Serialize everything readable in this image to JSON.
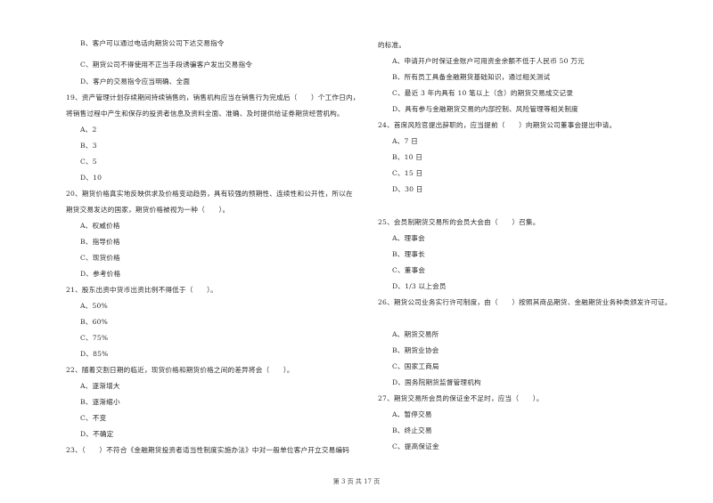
{
  "left_column": {
    "q18_options": {
      "B": "B、客户可以通过电话向期货公司下达交易指令",
      "C": "C、期货公司不得使用不正当手段诱骗客户发出交易指令",
      "D": "D、客户的交易指令应当明确、全面"
    },
    "q19": {
      "line1": "19、资产管理计划存续期间持续销售的，销售机构应当在销售行为完成后（　　）个工作日内，",
      "line2": "将销售过程中产生和保存的投资者信息及资料全面、准确、及时提供给证券期货经营机构。",
      "options": [
        "A、2",
        "B、3",
        "C、5",
        "D、10"
      ]
    },
    "q20": {
      "line1": "20、期货价格真实地反映供求及价格变动趋势，具有较强的预期性、连续性和公开性，所以在",
      "line2": "期货交易发达的国家，期货价格被视为一种（　　）。",
      "options": [
        "A、权威价格",
        "B、指导价格",
        "C、现货价格",
        "D、参考价格"
      ]
    },
    "q21": {
      "line1": "21、股东出资中货币出资比例不得低于（　　）。",
      "options": [
        "A、50%",
        "B、60%",
        "C、75%",
        "D、85%"
      ]
    },
    "q22": {
      "line1": "22、随着交割日期的临近，现货价格和期货价格之间的差异将会（　　）。",
      "options": [
        "A、逐渐增大",
        "B、逐渐缩小",
        "C、不变",
        "D、不确定"
      ]
    },
    "q23": {
      "line1": "23、（　　）不符合《金融期货投资者适当性制度实施办法》中对一般单位客户开立交易编码"
    }
  },
  "right_column": {
    "q23_cont": "的标准。",
    "q23_options": [
      "A、申请开户时保证金账户可用资金余额不低于人民币 50 万元",
      "B、所有员工具备金融期货基础知识，通过相关测试",
      "C、最近 3 年内具有 10 笔以上（含）的期货交易成交记录",
      "D、具有参与金融期货交易的内部控制、风险管理等相关制度"
    ],
    "q24": {
      "line1": "24、首席风险官提出辞职的，应当提前（　　）向期货公司董事会提出申请。",
      "options": [
        "A、7 日",
        "B、10 日",
        "C、15 日",
        "D、30 日"
      ]
    },
    "q25": {
      "line1": "25、会员制期货交易所的会员大会由（　　）召集。",
      "options": [
        "A、理事会",
        "B、理事长",
        "C、董事会",
        "D、1/3 以上会员"
      ]
    },
    "q26": {
      "line1": "26、期货公司业务实行许可制度，由（　　）按照其商品期货、金融期货业务种类颁发许可证。",
      "options": [
        "A、期货交易所",
        "B、期货业协会",
        "C、国家工商局",
        "D、国务院期货监督管理机构"
      ]
    },
    "q27": {
      "line1": "27、期货交易所会员的保证金不足时，应当（　　）。",
      "options": [
        "A、暂停交易",
        "B、终止交易",
        "C、提高保证金"
      ]
    }
  },
  "footer": {
    "page_label": "第 3 页 共 17 页"
  }
}
